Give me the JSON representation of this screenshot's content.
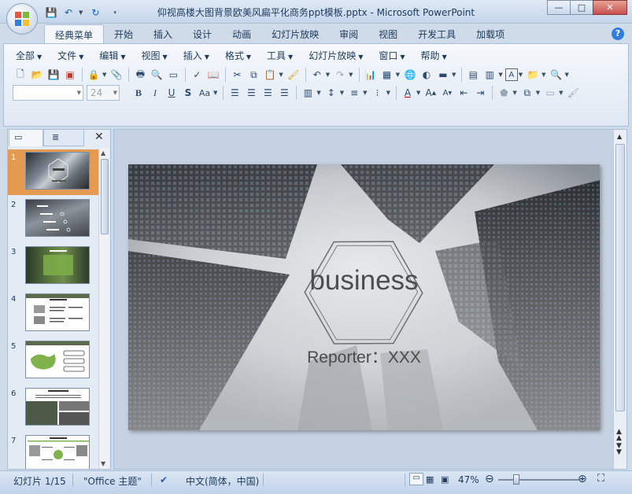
{
  "titlebar": {
    "title": "仰视高楼大图背景欧美风扁平化商务ppt模板.pptx - Microsoft PowerPoint",
    "minimize": "—",
    "maximize": "□",
    "close": "✕"
  },
  "tabs": [
    "经典菜单",
    "开始",
    "插入",
    "设计",
    "动画",
    "幻灯片放映",
    "审阅",
    "视图",
    "开发工具",
    "加载项"
  ],
  "help": "?",
  "menu": [
    "全部",
    "文件",
    "编辑",
    "视图",
    "插入",
    "格式",
    "工具",
    "幻灯片放映",
    "窗口",
    "帮助"
  ],
  "font": {
    "name": "",
    "size": "24"
  },
  "pane": {
    "close": "✕"
  },
  "slides": [
    {
      "num": "1"
    },
    {
      "num": "2"
    },
    {
      "num": "3"
    },
    {
      "num": "4"
    },
    {
      "num": "5"
    },
    {
      "num": "6"
    },
    {
      "num": "7"
    }
  ],
  "slide": {
    "title": "business",
    "subtitle": "Reporter：XXX"
  },
  "status": {
    "slide_count": "幻灯片 1/15",
    "theme": "\"Office 主题\"",
    "language": "中文(简体，中国)",
    "zoom": "47%"
  },
  "colors": {
    "accent": "#e59a52",
    "ribbon_blue": "#1e395b"
  }
}
